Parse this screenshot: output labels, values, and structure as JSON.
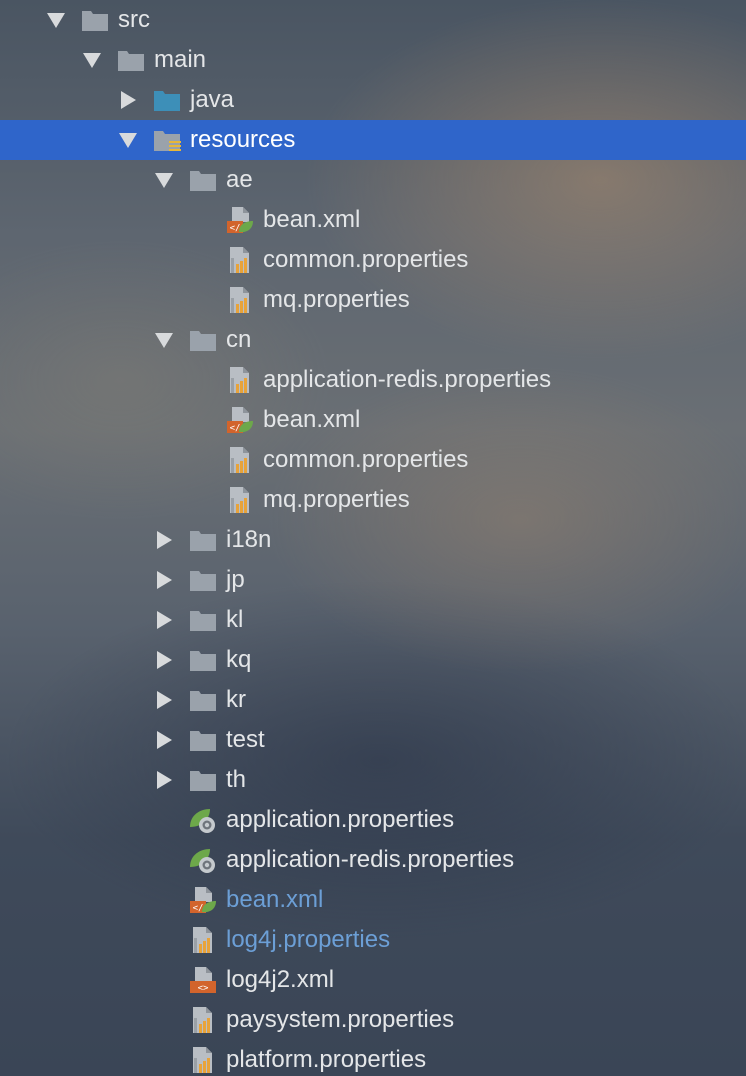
{
  "tree": {
    "rows": [
      {
        "label": "src",
        "icon": "folder-icon",
        "expanded": true,
        "level": 0
      },
      {
        "label": "main",
        "icon": "folder-icon",
        "expanded": true,
        "level": 1
      },
      {
        "label": "java",
        "icon": "source-folder-icon",
        "expanded": false,
        "level": 2
      },
      {
        "label": "resources",
        "icon": "resources-folder-icon",
        "expanded": true,
        "level": 2,
        "selected": true
      },
      {
        "label": "ae",
        "icon": "folder-icon",
        "expanded": true,
        "level": 3
      },
      {
        "label": "bean.xml",
        "icon": "spring-xml-icon",
        "level": 4
      },
      {
        "label": "common.properties",
        "icon": "properties-file-icon",
        "level": 4
      },
      {
        "label": "mq.properties",
        "icon": "properties-file-icon",
        "level": 4
      },
      {
        "label": "cn",
        "icon": "folder-icon",
        "expanded": true,
        "level": 3
      },
      {
        "label": "application-redis.properties",
        "icon": "properties-file-icon",
        "level": 4
      },
      {
        "label": "bean.xml",
        "icon": "spring-xml-icon",
        "level": 4
      },
      {
        "label": "common.properties",
        "icon": "properties-file-icon",
        "level": 4
      },
      {
        "label": "mq.properties",
        "icon": "properties-file-icon",
        "level": 4
      },
      {
        "label": "i18n",
        "icon": "folder-icon",
        "expanded": false,
        "level": 3
      },
      {
        "label": "jp",
        "icon": "folder-icon",
        "expanded": false,
        "level": 3
      },
      {
        "label": "kl",
        "icon": "folder-icon",
        "expanded": false,
        "level": 3
      },
      {
        "label": "kq",
        "icon": "folder-icon",
        "expanded": false,
        "level": 3
      },
      {
        "label": "kr",
        "icon": "folder-icon",
        "expanded": false,
        "level": 3
      },
      {
        "label": "test",
        "icon": "folder-icon",
        "expanded": false,
        "level": 3
      },
      {
        "label": "th",
        "icon": "folder-icon",
        "expanded": false,
        "level": 3
      },
      {
        "label": "application.properties",
        "icon": "spring-boot-properties-icon",
        "level": 3
      },
      {
        "label": "application-redis.properties",
        "icon": "spring-boot-properties-icon",
        "level": 3
      },
      {
        "label": "bean.xml",
        "icon": "spring-xml-icon",
        "level": 3,
        "modified": true
      },
      {
        "label": "log4j.properties",
        "icon": "properties-file-icon",
        "level": 3,
        "modified": true
      },
      {
        "label": "log4j2.xml",
        "icon": "xml-file-icon",
        "level": 3
      },
      {
        "label": "paysystem.properties",
        "icon": "properties-file-icon",
        "level": 3
      },
      {
        "label": "platform.properties",
        "icon": "properties-file-icon",
        "level": 3
      }
    ]
  },
  "colors": {
    "selection": "#2f65ca",
    "text": "#e4e6e8",
    "modified_text": "#6c9fd6",
    "folder": "#9aa2ab",
    "source_folder": "#3d8fb8",
    "properties_bars": "#e8a33a",
    "xml_tag": "#d2642c",
    "spring_leaf": "#6da84a"
  }
}
